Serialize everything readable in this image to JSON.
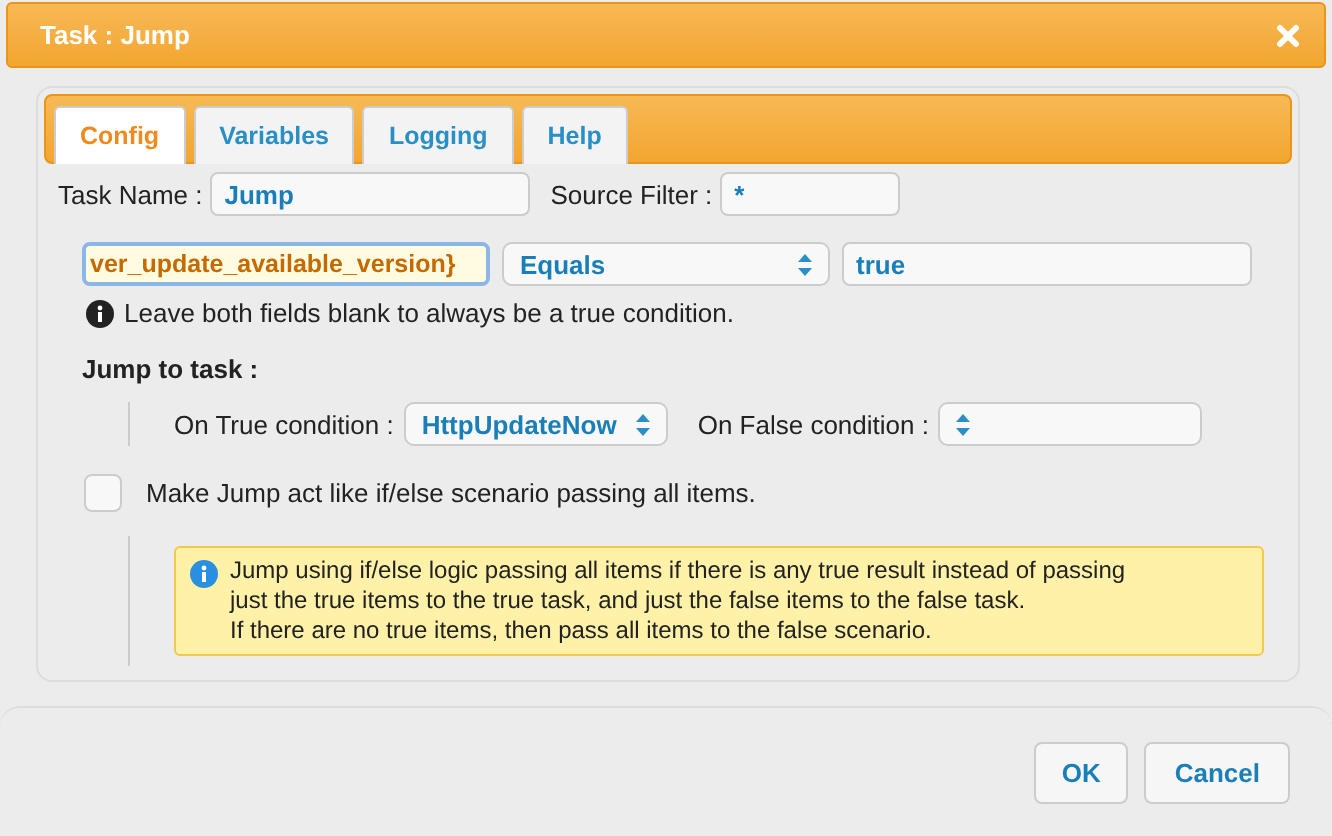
{
  "window": {
    "title": "Task : Jump"
  },
  "tabs": [
    {
      "label": "Config",
      "selected": true
    },
    {
      "label": "Variables",
      "selected": false
    },
    {
      "label": "Logging",
      "selected": false
    },
    {
      "label": "Help",
      "selected": false
    }
  ],
  "task_name": {
    "label": "Task Name :",
    "value": "Jump"
  },
  "source_filter": {
    "label": "Source Filter :",
    "value": "*"
  },
  "condition": {
    "field": "ver_update_available_version}",
    "operator": "Equals",
    "value": "true",
    "hint": "Leave both fields blank to always be a true condition."
  },
  "jump": {
    "heading": "Jump to task :",
    "true_label": "On True condition :",
    "true_value": "HttpUpdateNow",
    "false_label": "On False condition :"
  },
  "if_else": {
    "label": "Make Jump act like if/else scenario passing all items.",
    "checked": false,
    "note": [
      "Jump using if/else logic passing all items if there is any true result instead of passing",
      "just the true items to the true task, and just the false items to the false task.",
      "If there are no true items, then pass all items to the false scenario."
    ]
  },
  "buttons": [
    "OK",
    "Cancel"
  ]
}
